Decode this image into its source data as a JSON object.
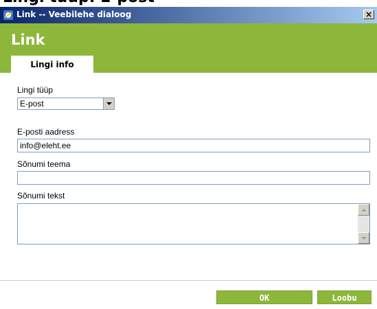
{
  "top_strip_text": "Lingi tüüp: E-post",
  "window": {
    "title": "Link -- Veebilehe dialoog",
    "close_glyph": "×"
  },
  "header": {
    "title": "Link"
  },
  "tab": {
    "label": "Lingi info"
  },
  "form": {
    "link_type_label": "Lingi tüüp",
    "link_type_value": "E-post",
    "email_label": "E-posti aadress",
    "email_value": "info@eleht.ee",
    "subject_label": "Sõnumi teema",
    "subject_value": "",
    "body_label": "Sõnumi tekst",
    "body_value": ""
  },
  "buttons": {
    "ok": "OK",
    "cancel": "Loobu"
  },
  "colors": {
    "accent": "#8cb73a",
    "titlebar": "#0a246a"
  },
  "icons": {
    "window": "app-icon",
    "close": "close-icon",
    "dropdown": "chevron-down-icon"
  }
}
